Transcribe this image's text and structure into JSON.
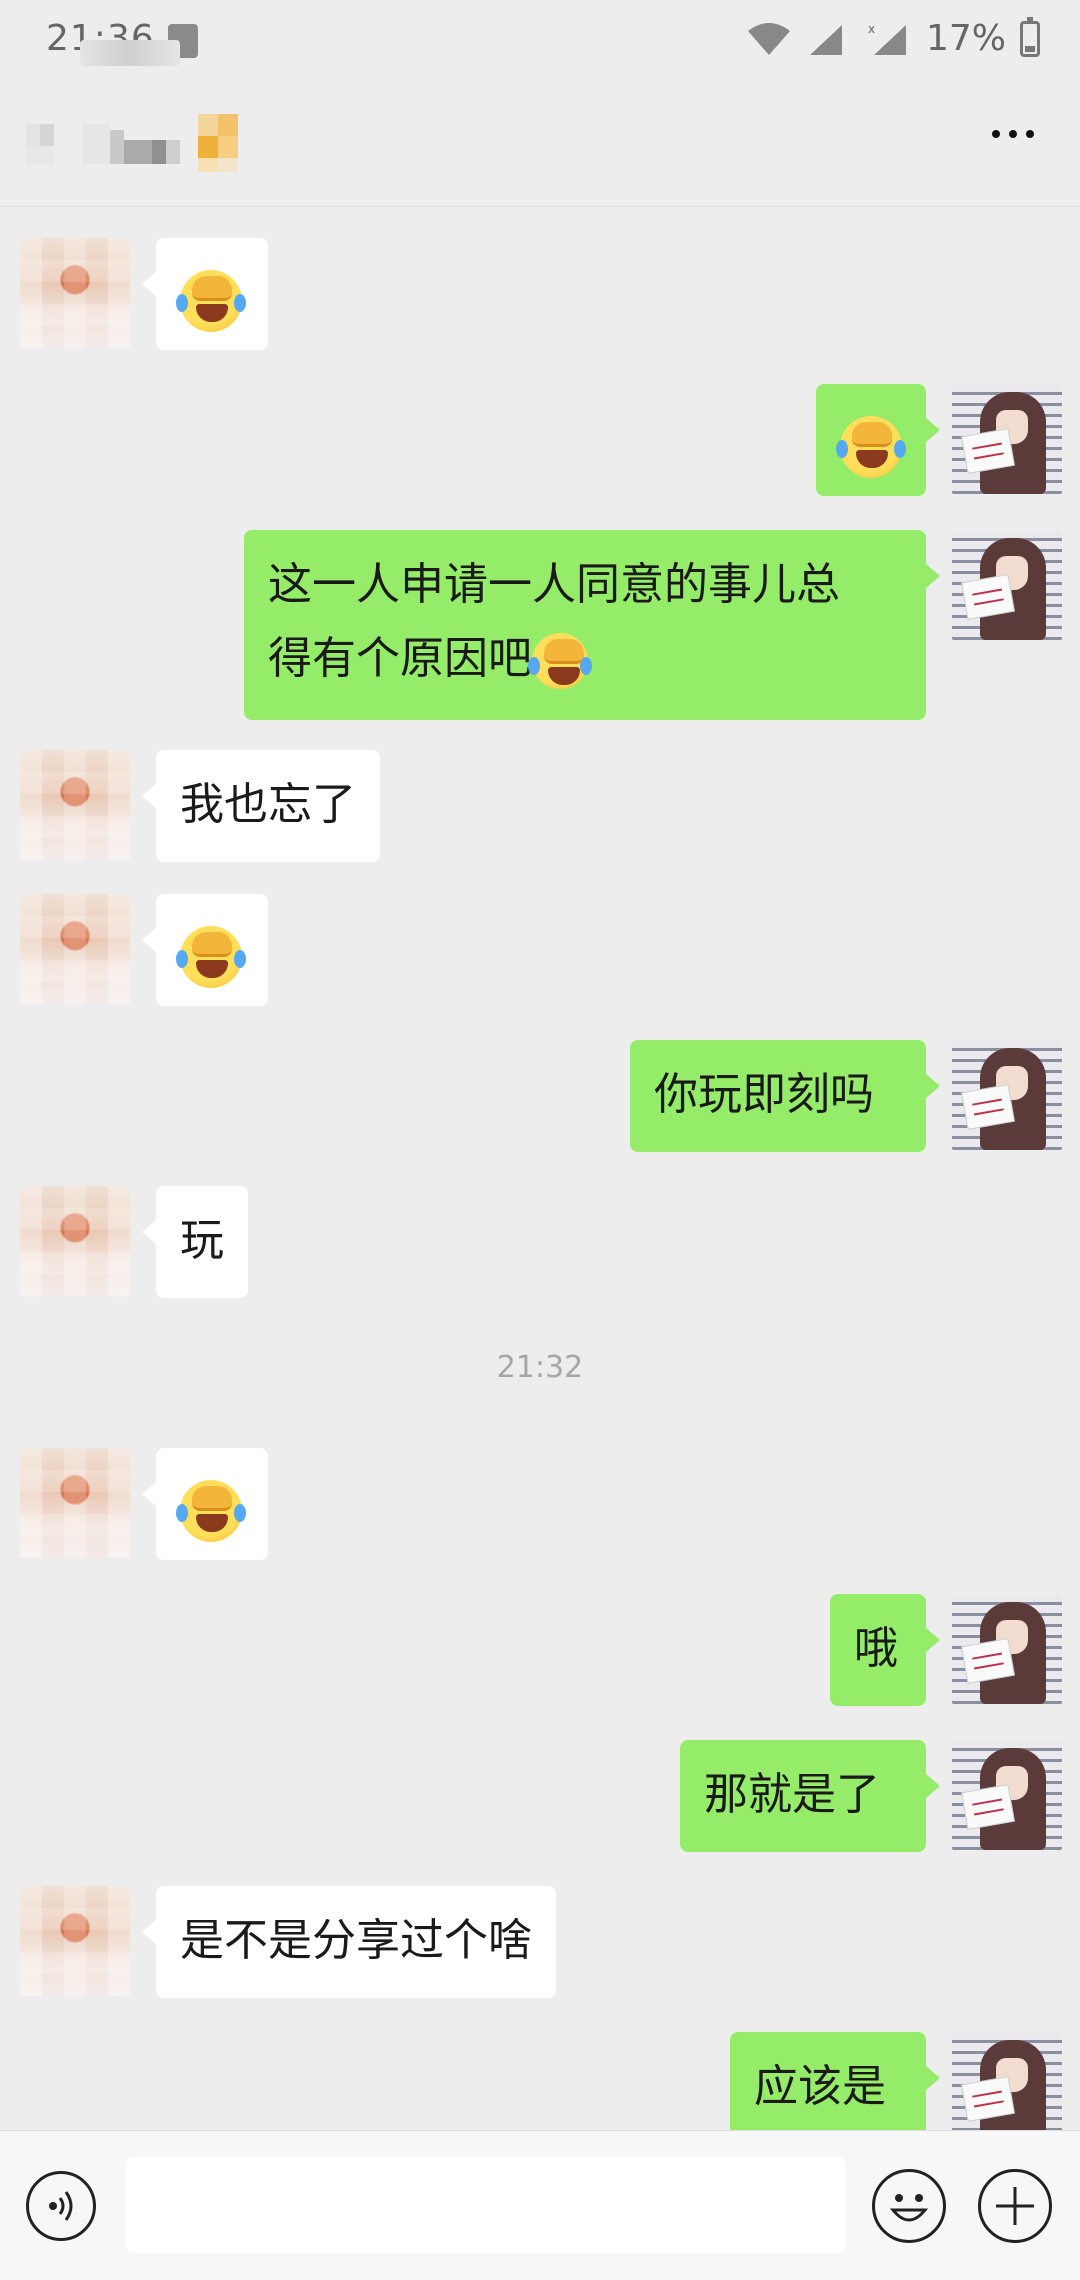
{
  "status_bar": {
    "time": "21:36",
    "battery": "17%"
  },
  "header": {
    "icons": [
      "more-icon"
    ]
  },
  "messages": [
    {
      "from": "them",
      "type": "emoji",
      "emoji": "facepalm-crying-emoji"
    },
    {
      "from": "me",
      "type": "emoji",
      "emoji": "facepalm-crying-emoji"
    },
    {
      "from": "me",
      "type": "text",
      "lines": [
        "这一人申请一人同意的事儿总",
        "得有个原因吧"
      ],
      "trailing_emoji": "facepalm-crying-emoji"
    },
    {
      "from": "them",
      "type": "text",
      "text": "我也忘了"
    },
    {
      "from": "them",
      "type": "emoji",
      "emoji": "facepalm-crying-emoji"
    },
    {
      "from": "me",
      "type": "text",
      "text": "你玩即刻吗"
    },
    {
      "from": "them",
      "type": "text",
      "text": "玩"
    },
    {
      "from": "them",
      "type": "emoji",
      "emoji": "facepalm-crying-emoji"
    },
    {
      "from": "me",
      "type": "text",
      "text": "哦"
    },
    {
      "from": "me",
      "type": "text",
      "text": "那就是了"
    },
    {
      "from": "them",
      "type": "text",
      "text": "是不是分享过个啥"
    },
    {
      "from": "me",
      "type": "text",
      "text": "应该是"
    }
  ],
  "timestamp": "21:32",
  "input_bar": {
    "input_value": "",
    "icons": [
      "voice-icon",
      "emoji-icon",
      "plus-icon"
    ]
  }
}
